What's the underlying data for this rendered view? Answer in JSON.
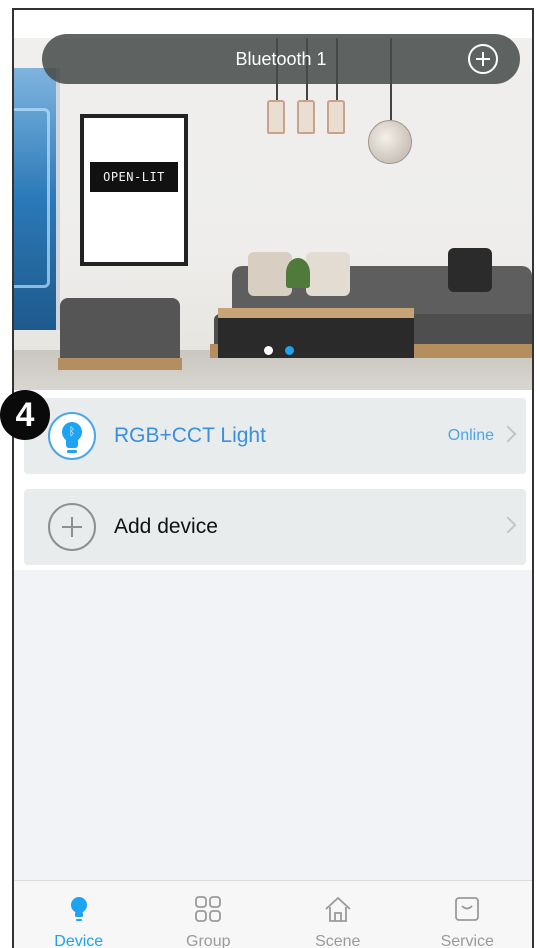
{
  "header": {
    "title": "Bluetooth 1",
    "add_icon": "plus-circle-icon"
  },
  "banner": {
    "poster_text": "OPEN-LIT",
    "carousel": {
      "count": 2,
      "active_index": 1
    }
  },
  "step_badge": "4",
  "devices": [
    {
      "name": "RGB+CCT Light",
      "status": "Online",
      "icon": "bluetooth-bulb-icon"
    }
  ],
  "add_device": {
    "label": "Add device",
    "icon": "plus-circle-icon"
  },
  "tabs": [
    {
      "label": "Device",
      "icon": "lightbulb-icon",
      "active": true
    },
    {
      "label": "Group",
      "icon": "grid-icon",
      "active": false
    },
    {
      "label": "Scene",
      "icon": "home-icon",
      "active": false
    },
    {
      "label": "Service",
      "icon": "service-box-icon",
      "active": false
    }
  ],
  "colors": {
    "accent": "#1ca3f2",
    "inactive": "#9a9a9a",
    "card_bg": "#e9ecec"
  }
}
